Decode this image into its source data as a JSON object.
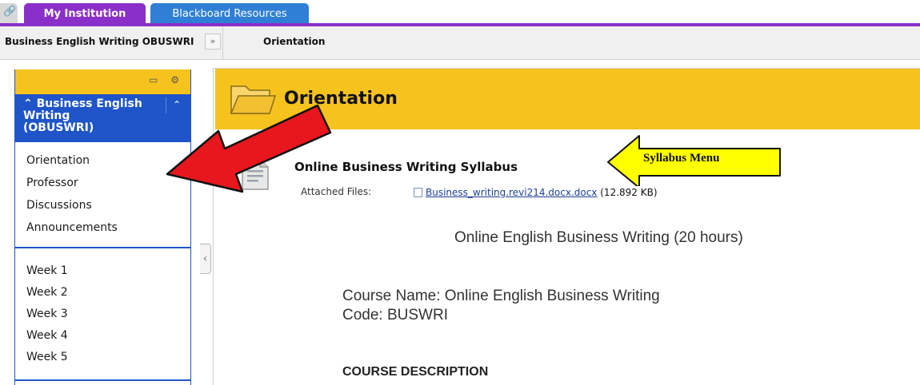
{
  "tabs": {
    "lock_icon": "lock-icon",
    "my_institution": "My Institution",
    "blackboard_resources": "Blackboard Resources"
  },
  "breadcrumb": {
    "course": "Business English Writing OBUSWRI",
    "toggle_icon": "double-chevron-down-icon",
    "current": "Orientation"
  },
  "sidebar": {
    "course_title": "Business English Writing (OBUSWRI)",
    "menu_items": [
      "Orientation",
      "Professor",
      "Discussions",
      "Announcements"
    ],
    "week_items": [
      "Week 1",
      "Week 2",
      "Week 3",
      "Week 4",
      "Week 5"
    ]
  },
  "content": {
    "page_title": "Orientation",
    "item_title": "Online Business Writing Syllabus",
    "attached_label": "Attached Files:",
    "attachment_name": "Business_writing.revi214.docx.docx",
    "attachment_size": "(12.892 KB)",
    "doc_heading": "Online English Business Writing (20 hours)",
    "doc_course_name": "Course Name: Online English Business Writing",
    "doc_code": "Code: BUSWRI",
    "doc_section": "COURSE DESCRIPTION"
  },
  "annotations": {
    "syllabus_label": "Syllabus Menu"
  },
  "colors": {
    "accent_purple": "#8b2fc9",
    "tab_blue": "#2f7fd6",
    "menu_blue": "#1f55c9",
    "header_yellow": "#f6c21e",
    "arrow_red": "#e8161d",
    "arrow_yellow": "#ffff00"
  }
}
